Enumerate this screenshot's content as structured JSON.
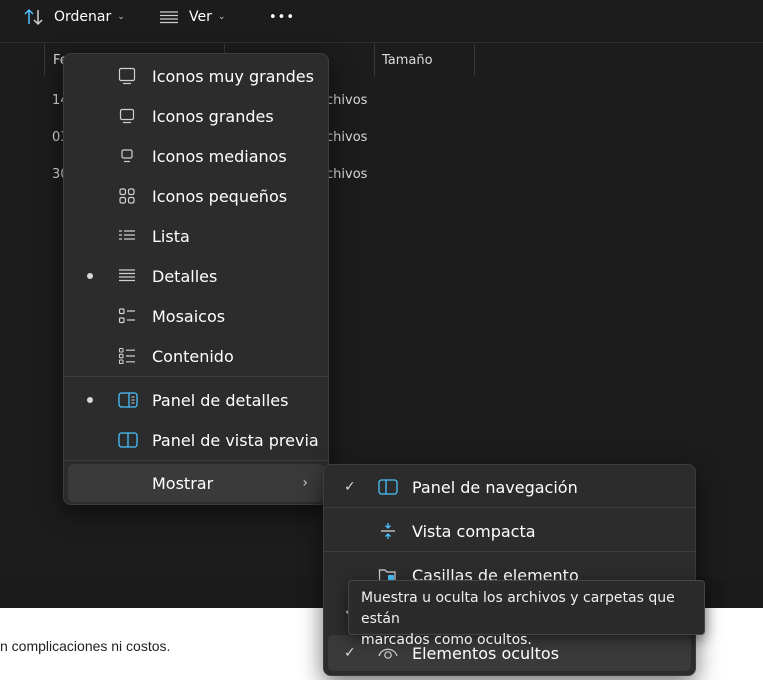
{
  "toolbar": {
    "sort_label": "Ordenar",
    "view_label": "Ver",
    "more_label": "•••"
  },
  "columns": {
    "date_partial": "Fe",
    "size": "Tamaño"
  },
  "rows": [
    {
      "date_partial": "14",
      "type_partial": "chivos"
    },
    {
      "date_partial": "03",
      "type_partial": "chivos"
    },
    {
      "date_partial": "30",
      "type_partial": "chivos"
    }
  ],
  "view_menu": {
    "items": [
      {
        "label": "Iconos muy grandes",
        "icon": "monitor-large-icon",
        "selected": false
      },
      {
        "label": "Iconos grandes",
        "icon": "monitor-icon",
        "selected": false
      },
      {
        "label": "Iconos medianos",
        "icon": "monitor-small-icon",
        "selected": false
      },
      {
        "label": "Iconos pequeños",
        "icon": "grid-icon",
        "selected": false
      },
      {
        "label": "Lista",
        "icon": "list-icon",
        "selected": false
      },
      {
        "label": "Detalles",
        "icon": "details-icon",
        "selected": true
      },
      {
        "label": "Mosaicos",
        "icon": "tiles-icon",
        "selected": false
      },
      {
        "label": "Contenido",
        "icon": "content-icon",
        "selected": false
      }
    ],
    "pane_items": [
      {
        "label": "Panel de detalles",
        "icon": "details-pane-icon",
        "selected": true
      },
      {
        "label": "Panel de vista previa",
        "icon": "preview-pane-icon",
        "selected": false
      }
    ],
    "show_label": "Mostrar"
  },
  "show_submenu": {
    "items": [
      {
        "label": "Panel de navegación",
        "icon": "navigation-pane-icon",
        "checked": true
      },
      {
        "label": "Vista compacta",
        "icon": "compact-view-icon",
        "checked": false
      },
      {
        "label": "Casillas de elemento",
        "icon": "item-checkbox-icon",
        "checked": false
      },
      {
        "label": "Elementos ocultos",
        "icon": "hidden-items-icon",
        "checked": true
      }
    ]
  },
  "tooltip": {
    "line1": "Muestra u oculta los archivos y carpetas que están",
    "line2": "marcados como ocultos."
  },
  "document": {
    "text_fragment": "n complicaciones ni costos."
  },
  "colors": {
    "accent": "#4cc2ff",
    "menu_bg": "#2c2c2c",
    "background": "#1c1c1c"
  }
}
